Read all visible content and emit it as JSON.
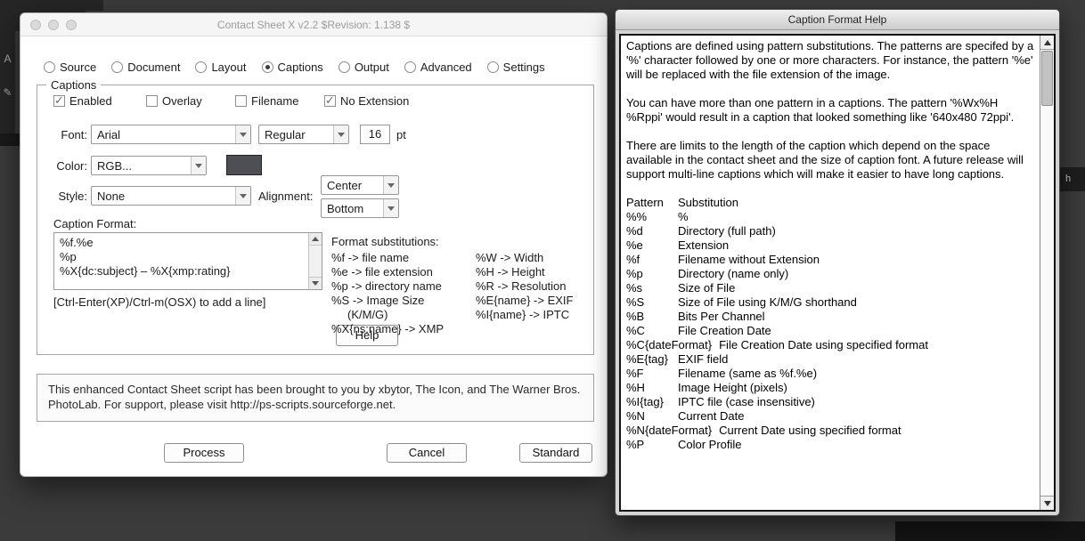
{
  "desktop": {
    "left_toolbar_icons": [
      {
        "name": "type-tool",
        "glyph": "A"
      },
      {
        "name": "pen-tool",
        "glyph": "✎"
      }
    ],
    "right_tab_label": "h"
  },
  "main_window": {
    "title": "Contact Sheet X v2.2 $Revision: 1.138 $",
    "tabs": [
      {
        "label": "Source",
        "selected": false
      },
      {
        "label": "Document",
        "selected": false
      },
      {
        "label": "Layout",
        "selected": false
      },
      {
        "label": "Captions",
        "selected": true
      },
      {
        "label": "Output",
        "selected": false
      },
      {
        "label": "Advanced",
        "selected": false
      },
      {
        "label": "Settings",
        "selected": false
      }
    ],
    "captions": {
      "legend": "Captions",
      "checkboxes": [
        {
          "label": "Enabled",
          "checked": true
        },
        {
          "label": "Overlay",
          "checked": false
        },
        {
          "label": "Filename",
          "checked": false
        },
        {
          "label": "No Extension",
          "checked": true
        }
      ],
      "font": {
        "label": "Font:",
        "family": "Arial",
        "style": "Regular",
        "size": "16",
        "unit": "pt"
      },
      "color": {
        "label": "Color:",
        "value": "RGB...",
        "swatch": "#4e4e55"
      },
      "style": {
        "label": "Style:",
        "value": "None"
      },
      "alignment": {
        "label": "Alignment:",
        "horizontal": "Center",
        "vertical": "Bottom"
      },
      "caption_format": {
        "label": "Caption Format:",
        "lines": [
          "%f.%e",
          "%p",
          "%X{dc:subject} – %X{xmp:rating}"
        ],
        "hint": "[Ctrl-Enter(XP)/Ctrl-m(OSX) to add a line]"
      },
      "substitutions": {
        "title": "Format substitutions:",
        "col1": [
          "%f -> file name",
          "%e -> file extension",
          "%p -> directory name",
          "%S -> Image Size",
          "(K/M/G)",
          "%X{ns:name} -> XMP"
        ],
        "col2": [
          "%W -> Width",
          "%H -> Height",
          "%R -> Resolution",
          "%E{name} -> EXIF",
          "%I{name} -> IPTC"
        ]
      },
      "help_button": "Help"
    },
    "credits": "This enhanced Contact Sheet script has been brought to you by xbytor, The Icon, and The Warner Bros. PhotoLab. For support, please visit http://ps-scripts.sourceforge.net.",
    "buttons": {
      "process": "Process",
      "cancel": "Cancel",
      "standard": "Standard"
    }
  },
  "help_window": {
    "title": "Caption Format Help",
    "paragraphs": [
      "Captions are defined using pattern substitutions. The patterns are specifed by a '%' character followed by one or more characters. For instance, the pattern '%e' will be replaced with the file extension of the image.",
      "You can have more than one pattern in a captions. The pattern '%Wx%H %Rppi' would result in a caption that looked something like '640x480 72ppi'.",
      "There are limits to the length of the caption which depend on the space available in the contact sheet and the size of caption font. A future release will support multi-line captions which will make it easier to have long captions."
    ],
    "table": {
      "header": {
        "pattern": "Pattern",
        "substitution": "Substitution"
      },
      "rows": [
        {
          "p": "%%",
          "s": "%"
        },
        {
          "p": "%d",
          "s": "Directory (full path)"
        },
        {
          "p": "%e",
          "s": "Extension"
        },
        {
          "p": "%f",
          "s": "Filename without Extension"
        },
        {
          "p": "%p",
          "s": "Directory (name only)"
        },
        {
          "p": "%s",
          "s": "Size of File"
        },
        {
          "p": "%S",
          "s": "Size of File using K/M/G shorthand"
        },
        {
          "p": "%B",
          "s": "Bits Per Channel"
        },
        {
          "p": "%C",
          "s": "File Creation Date"
        },
        {
          "p": "%C{dateFormat}",
          "s": "File Creation Date using specified format"
        },
        {
          "p": "%E{tag}",
          "s": "EXIF field"
        },
        {
          "p": "%F",
          "s": "Filename (same as %f.%e)"
        },
        {
          "p": "%H",
          "s": "Image Height (pixels)"
        },
        {
          "p": "%I{tag}",
          "s": "IPTC file (case insensitive)"
        },
        {
          "p": "%N",
          "s": "Current Date"
        },
        {
          "p": "%N{dateFormat}",
          "s": "Current Date using specified format"
        },
        {
          "p": "%P",
          "s": "Color Profile"
        }
      ]
    }
  }
}
